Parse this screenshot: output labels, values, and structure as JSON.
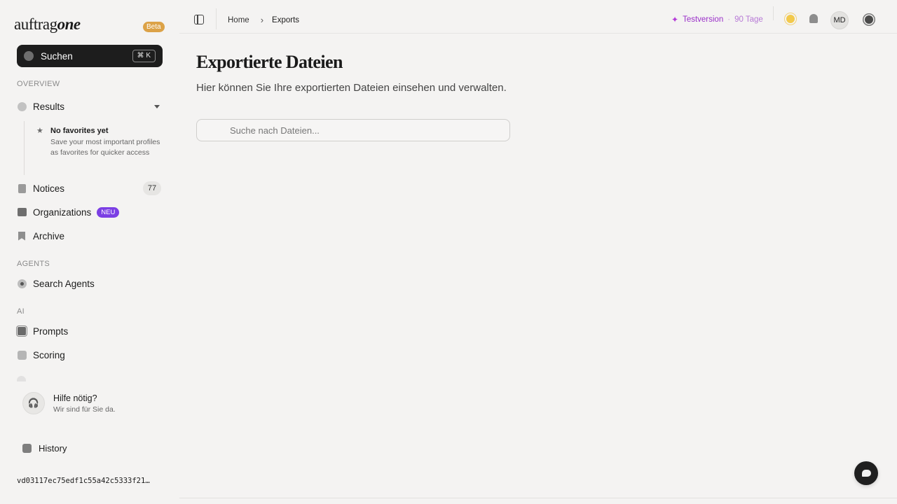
{
  "brand": {
    "name_part1": "auftrag",
    "name_part2": "one",
    "badge": "Beta"
  },
  "search": {
    "label": "Suchen",
    "shortcut": "⌘ K"
  },
  "sidebar": {
    "sections": {
      "overview": "OVERVIEW",
      "agents": "AGENTS",
      "ai": "AI"
    },
    "items": {
      "results": {
        "label": "Results",
        "icon": "results-icon"
      },
      "notices": {
        "label": "Notices",
        "count": "77",
        "icon": "document-icon"
      },
      "organizations": {
        "label": "Organizations",
        "badge": "NEU",
        "icon": "building-icon"
      },
      "archive": {
        "label": "Archive",
        "icon": "bookmark-icon"
      },
      "search_agents": {
        "label": "Search Agents",
        "icon": "agent-icon"
      },
      "prompts": {
        "label": "Prompts",
        "icon": "chip-icon"
      },
      "scoring": {
        "label": "Scoring",
        "icon": "scoring-icon"
      }
    },
    "favorites": {
      "title": "No favorites yet",
      "description": "Save your most important profiles as favorites for quicker access"
    },
    "help": {
      "title": "Hilfe nötig?",
      "subtitle": "Wir sind für Sie da."
    },
    "history": {
      "label": "History"
    },
    "version": "vd03117ec75edf1c55a42c5333f21…"
  },
  "header": {
    "breadcrumb": {
      "home": "Home",
      "separator": "›",
      "current": "Exports"
    },
    "trial": {
      "label": "Testversion",
      "dot": "·",
      "days": "90 Tage"
    },
    "avatar_initials": "MD"
  },
  "main": {
    "title": "Exportierte Dateien",
    "subtitle": "Hier können Sie Ihre exportierten Dateien einsehen und verwalten.",
    "file_search_placeholder": "Suche nach Dateien..."
  },
  "colors": {
    "accent_purple": "#7b3fe4",
    "trial_purple": "#9a2fc9",
    "beta_orange": "#dca247",
    "background": "#f4f3f2"
  }
}
